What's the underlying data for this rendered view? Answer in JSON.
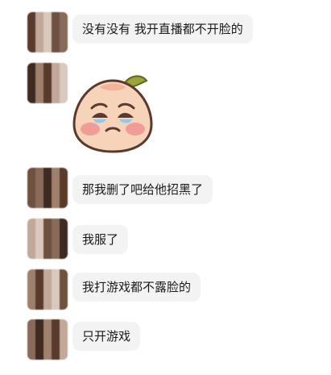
{
  "messages": [
    {
      "type": "text",
      "text": "没有没有 我开直播都不开脸的"
    },
    {
      "type": "sticker",
      "icon": "crying-peach-sticker-icon"
    },
    {
      "type": "text",
      "text": "那我删了吧给他招黑了"
    },
    {
      "type": "text",
      "text": "我服了"
    },
    {
      "type": "text",
      "text": "我打游戏都不露脸的"
    },
    {
      "type": "text",
      "text": "只开游戏"
    }
  ],
  "colors": {
    "bubble_bg": "#f3f3f3",
    "text": "#1a1a1a",
    "avatar_palette": [
      "#5a3b2b",
      "#8a6a58",
      "#c2a898",
      "#3e2a20",
      "#d9c8bd",
      "#a07f6c",
      "#6f5140"
    ]
  }
}
